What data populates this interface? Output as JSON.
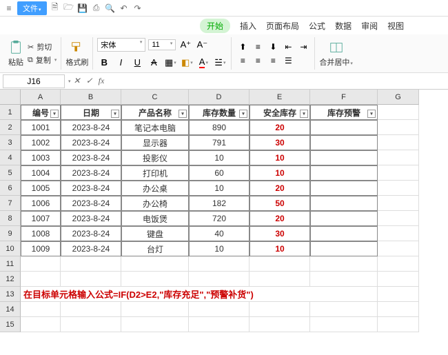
{
  "topbar": {
    "file_label": "文件"
  },
  "menubar": {
    "start": "开始",
    "insert": "插入",
    "page_layout": "页面布局",
    "formulas": "公式",
    "data": "数据",
    "review": "审阅",
    "view": "视图"
  },
  "ribbon": {
    "paste": "粘贴",
    "cut": "剪切",
    "copy": "复制",
    "format_painter": "格式刷",
    "font_name": "宋体",
    "font_size": "11",
    "merge_center": "合并居中"
  },
  "cellref": {
    "active": "J16"
  },
  "columns": [
    "A",
    "B",
    "C",
    "D",
    "E",
    "F",
    "G"
  ],
  "headers": {
    "a": "编号",
    "b": "日期",
    "c": "产品名称",
    "d": "库存数量",
    "e": "安全库存",
    "f": "库存预警"
  },
  "rows": [
    {
      "a": "1001",
      "b": "2023-8-24",
      "c": "笔记本电脑",
      "d": "890",
      "e": "20",
      "f": ""
    },
    {
      "a": "1002",
      "b": "2023-8-24",
      "c": "显示器",
      "d": "791",
      "e": "30",
      "f": ""
    },
    {
      "a": "1003",
      "b": "2023-8-24",
      "c": "投影仪",
      "d": "10",
      "e": "10",
      "f": ""
    },
    {
      "a": "1004",
      "b": "2023-8-24",
      "c": "打印机",
      "d": "60",
      "e": "10",
      "f": ""
    },
    {
      "a": "1005",
      "b": "2023-8-24",
      "c": "办公桌",
      "d": "10",
      "e": "20",
      "f": ""
    },
    {
      "a": "1006",
      "b": "2023-8-24",
      "c": "办公椅",
      "d": "182",
      "e": "50",
      "f": ""
    },
    {
      "a": "1007",
      "b": "2023-8-24",
      "c": "电饭煲",
      "d": "720",
      "e": "20",
      "f": ""
    },
    {
      "a": "1008",
      "b": "2023-8-24",
      "c": "键盘",
      "d": "40",
      "e": "30",
      "f": ""
    },
    {
      "a": "1009",
      "b": "2023-8-24",
      "c": "台灯",
      "d": "10",
      "e": "10",
      "f": ""
    }
  ],
  "note": "在目标单元格输入公式=IF(D2>E2,\"库存充足\",\"预警补货\")",
  "row_nums": [
    "1",
    "2",
    "3",
    "4",
    "5",
    "6",
    "7",
    "8",
    "9",
    "10",
    "11",
    "12",
    "13",
    "14",
    "15"
  ]
}
